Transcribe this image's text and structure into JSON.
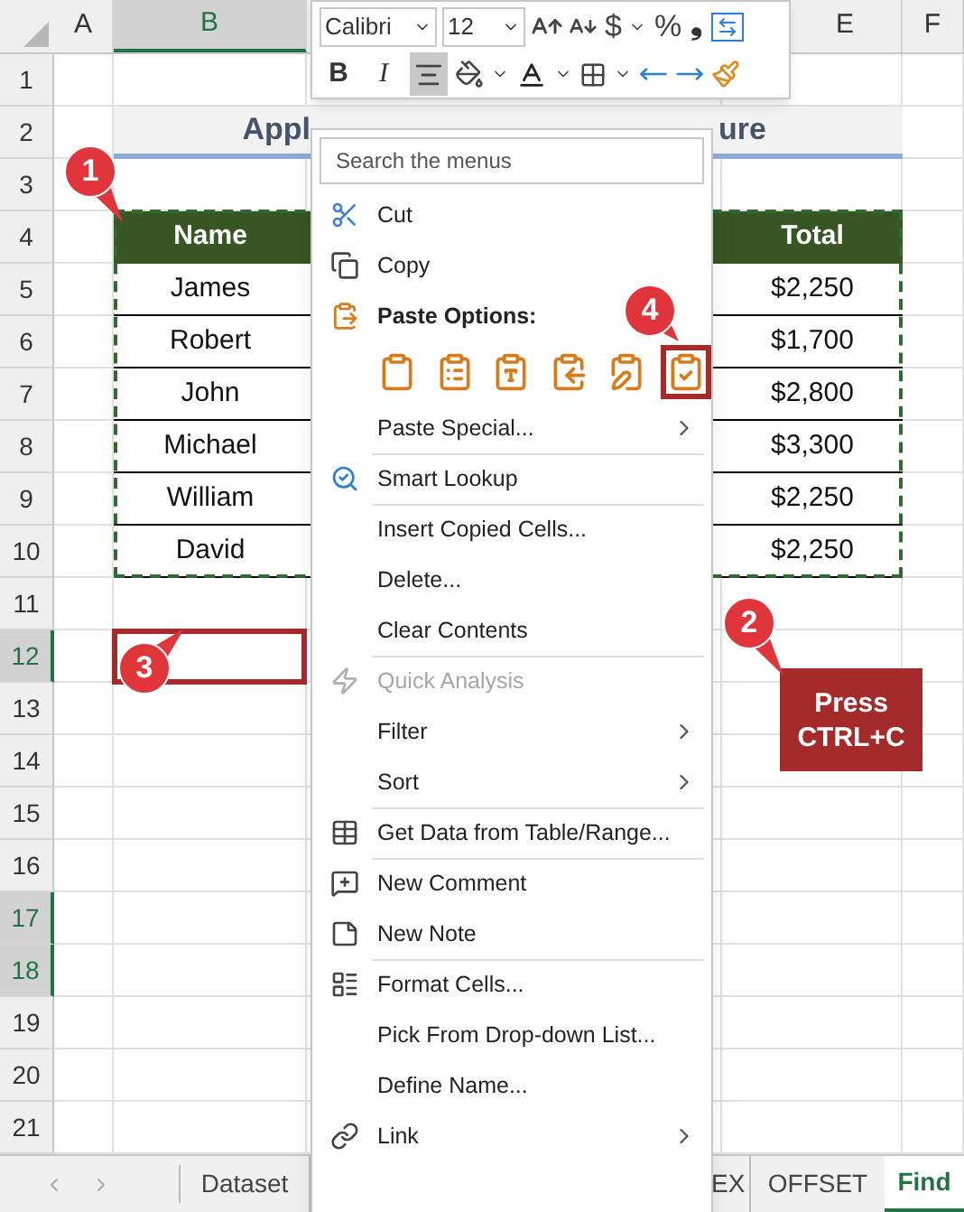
{
  "column_headers": [
    {
      "label": "A",
      "selected": false
    },
    {
      "label": "B",
      "selected": true
    },
    {
      "label": "E",
      "selected": false
    },
    {
      "label": "F",
      "selected": false
    }
  ],
  "row_headers": [
    {
      "label": "1",
      "selected": false
    },
    {
      "label": "2",
      "selected": false
    },
    {
      "label": "3",
      "selected": false
    },
    {
      "label": "4",
      "selected": false
    },
    {
      "label": "5",
      "selected": false
    },
    {
      "label": "6",
      "selected": false
    },
    {
      "label": "7",
      "selected": false
    },
    {
      "label": "8",
      "selected": false
    },
    {
      "label": "9",
      "selected": false
    },
    {
      "label": "10",
      "selected": false
    },
    {
      "label": "11",
      "selected": false
    },
    {
      "label": "12",
      "selected": true
    },
    {
      "label": "13",
      "selected": false
    },
    {
      "label": "14",
      "selected": false
    },
    {
      "label": "15",
      "selected": false
    },
    {
      "label": "16",
      "selected": false
    },
    {
      "label": "17",
      "selected": true
    },
    {
      "label": "18",
      "selected": true
    },
    {
      "label": "19",
      "selected": false
    },
    {
      "label": "20",
      "selected": false
    },
    {
      "label": "21",
      "selected": false
    }
  ],
  "title_parts": [
    "Appl",
    "ure"
  ],
  "table": {
    "headers": [
      "Name",
      "Total"
    ],
    "rows": [
      {
        "name": "James",
        "total": "$2,250"
      },
      {
        "name": "Robert",
        "total": "$1,700"
      },
      {
        "name": "John",
        "total": "$2,800"
      },
      {
        "name": "Michael",
        "total": "$3,300"
      },
      {
        "name": "William",
        "total": "$2,250"
      },
      {
        "name": "David",
        "total": "$2,250"
      }
    ]
  },
  "mini_toolbar": {
    "font_name": "Calibri",
    "font_size": "12",
    "currency": "$",
    "percent": "%",
    "comma": "❟",
    "format_buttons": [
      {
        "label": "B",
        "selected": false
      },
      {
        "label": "I",
        "selected": false
      },
      {
        "kind": "align",
        "selected": true
      }
    ]
  },
  "context_menu": {
    "search_placeholder": "Search the menus",
    "items": [
      {
        "kind": "item",
        "label": "Cut",
        "disabled": false,
        "submenu": false,
        "divider_before": false
      },
      {
        "kind": "item",
        "label": "Copy",
        "disabled": false,
        "submenu": false,
        "divider_before": false
      },
      {
        "kind": "heading",
        "label": "Paste Options:",
        "disabled": false,
        "submenu": false,
        "divider_before": false
      },
      {
        "kind": "paste_row"
      },
      {
        "kind": "item",
        "label": "Paste Special...",
        "disabled": false,
        "submenu": true,
        "divider_before": false
      },
      {
        "kind": "item",
        "label": "Smart Lookup",
        "disabled": false,
        "submenu": false,
        "divider_before": true
      },
      {
        "kind": "item",
        "label": "Insert Copied Cells...",
        "disabled": false,
        "submenu": false,
        "divider_before": true
      },
      {
        "kind": "item",
        "label": "Delete...",
        "disabled": false,
        "submenu": false,
        "divider_before": false
      },
      {
        "kind": "item",
        "label": "Clear Contents",
        "disabled": false,
        "submenu": false,
        "divider_before": false
      },
      {
        "kind": "item",
        "label": "Quick Analysis",
        "disabled": true,
        "submenu": false,
        "divider_before": true
      },
      {
        "kind": "item",
        "label": "Filter",
        "disabled": false,
        "submenu": true,
        "divider_before": false
      },
      {
        "kind": "item",
        "label": "Sort",
        "disabled": false,
        "submenu": true,
        "divider_before": false
      },
      {
        "kind": "item",
        "label": "Get Data from Table/Range...",
        "disabled": false,
        "submenu": false,
        "divider_before": true
      },
      {
        "kind": "item",
        "label": "New Comment",
        "disabled": false,
        "submenu": false,
        "divider_before": true
      },
      {
        "kind": "item",
        "label": "New Note",
        "disabled": false,
        "submenu": false,
        "divider_before": false
      },
      {
        "kind": "item",
        "label": "Format Cells...",
        "disabled": false,
        "submenu": false,
        "divider_before": true
      },
      {
        "kind": "item",
        "label": "Pick From Drop-down List...",
        "disabled": false,
        "submenu": false,
        "divider_before": false
      },
      {
        "kind": "item",
        "label": "Define Name...",
        "disabled": false,
        "submenu": false,
        "divider_before": false
      },
      {
        "kind": "item",
        "label": "Link",
        "disabled": false,
        "submenu": true,
        "divider_before": false
      }
    ],
    "paste_options": [
      {
        "highlighted": false
      },
      {
        "highlighted": false
      },
      {
        "highlighted": false
      },
      {
        "highlighted": false
      },
      {
        "highlighted": false
      },
      {
        "highlighted": true
      }
    ]
  },
  "callouts": [
    {
      "number": "1"
    },
    {
      "number": "2"
    },
    {
      "number": "3"
    },
    {
      "number": "4"
    }
  ],
  "note": "Press CTRL+C",
  "sheet_tabs": [
    {
      "label": "Dataset",
      "selected": false
    },
    {
      "label": "EX",
      "selected": false
    },
    {
      "label": "OFFSET",
      "selected": false
    },
    {
      "label": "Find",
      "selected": true
    }
  ]
}
